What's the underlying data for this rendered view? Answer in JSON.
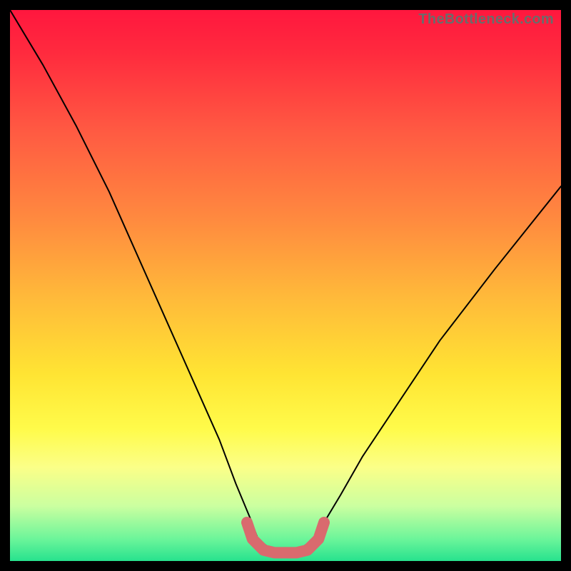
{
  "watermark": "TheBottleneck.com",
  "chart_data": {
    "type": "line",
    "title": "",
    "xlabel": "",
    "ylabel": "",
    "xlim": [
      0,
      100
    ],
    "ylim": [
      0,
      100
    ],
    "series": [
      {
        "name": "bottleneck-curve",
        "x": [
          0,
          6,
          12,
          18,
          22,
          26,
          30,
          34,
          38,
          41,
          43.5,
          45,
          47.5,
          50,
          52.5,
          55,
          57,
          60,
          64,
          70,
          78,
          88,
          100
        ],
        "values": [
          100,
          90,
          79,
          67,
          58,
          49,
          40,
          31,
          22,
          14,
          8,
          4,
          2,
          2,
          2,
          4,
          7,
          12,
          19,
          28,
          40,
          53,
          68
        ]
      },
      {
        "name": "sweet-spot-band",
        "x": [
          43,
          44,
          46,
          48,
          50,
          52,
          54,
          56,
          57
        ],
        "values": [
          7,
          4,
          2,
          1.5,
          1.5,
          1.5,
          2,
          4,
          7
        ]
      }
    ],
    "colors": {
      "curve": "#000000",
      "band": "#d96a6e"
    }
  }
}
